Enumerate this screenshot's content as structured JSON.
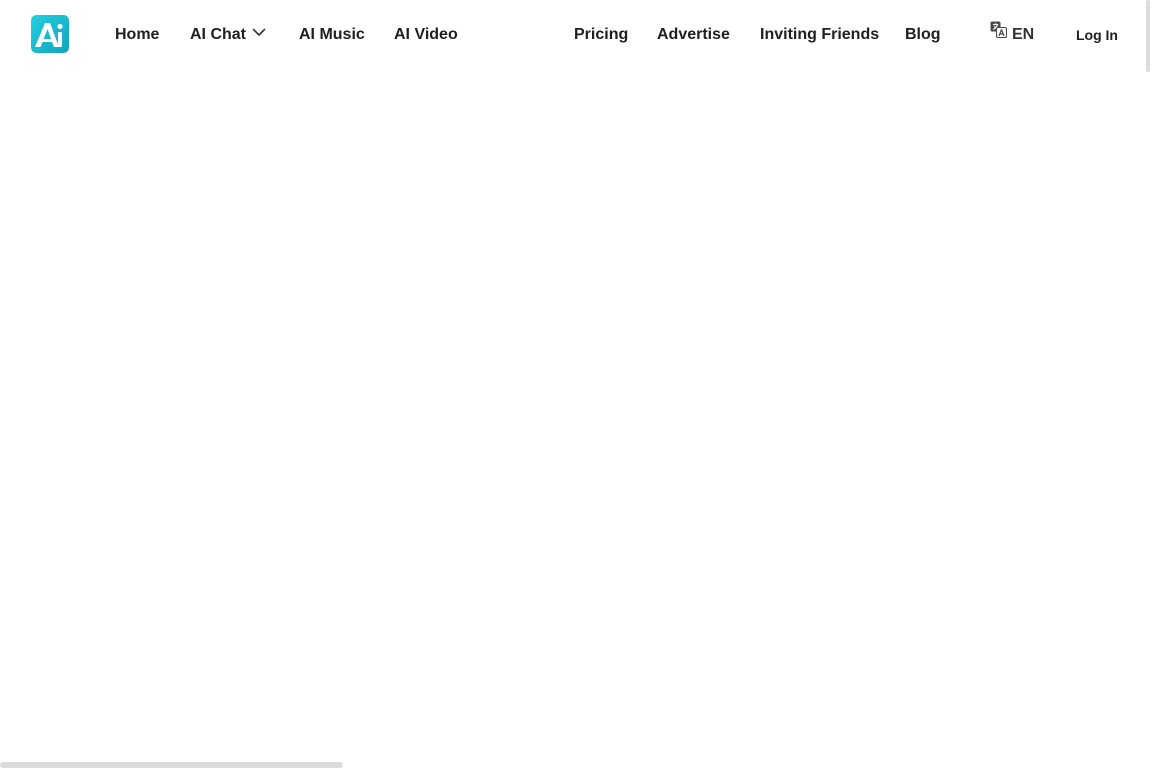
{
  "brand": {
    "logo_icon": "ai-logo-icon",
    "gradient_start": "#1fc8d8",
    "gradient_end": "#16a9c5"
  },
  "nav": {
    "left": [
      {
        "label": "Home"
      },
      {
        "label": "AI Chat",
        "has_dropdown": true
      },
      {
        "label": "AI Music"
      },
      {
        "label": "AI Video"
      }
    ],
    "right": [
      {
        "label": "Pricing"
      },
      {
        "label": "Advertise"
      },
      {
        "label": "Inviting Friends"
      },
      {
        "label": "Blog"
      }
    ]
  },
  "language": {
    "icon": "translate-icon",
    "label": "EN"
  },
  "auth": {
    "login_label": "Log In"
  }
}
